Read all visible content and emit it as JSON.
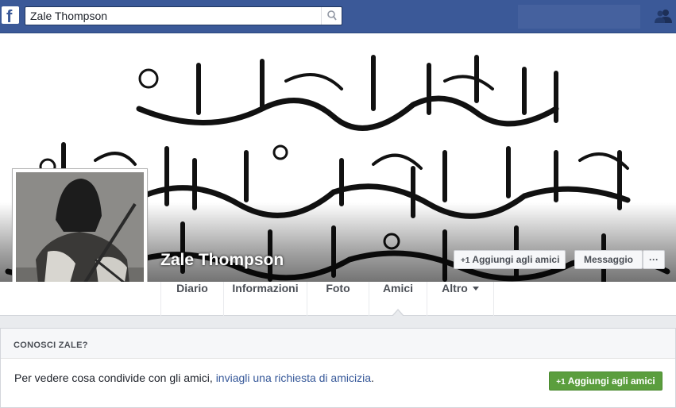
{
  "topbar": {
    "logo_letter": "f",
    "search_value": "Zale Thompson"
  },
  "profile": {
    "name": "Zale Thompson",
    "add_friend_label": "Aggiungi agli amici",
    "message_label": "Messaggio",
    "more_label": "···",
    "plus_one": "+1"
  },
  "tabs": [
    {
      "label": "Diario"
    },
    {
      "label": "Informazioni"
    },
    {
      "label": "Foto"
    },
    {
      "label": "Amici"
    },
    {
      "label": "Altro"
    }
  ],
  "friend_box": {
    "title": "CONOSCI ZALE?",
    "text_before_link": "Per vedere cosa condivide con gli amici, ",
    "link_text": "inviagli una richiesta di amicizia",
    "text_after_link": ".",
    "button_label": "Aggiungi agli amici",
    "button_plus_one": "+1"
  },
  "colors": {
    "brand_blue": "#3b5998",
    "link_blue": "#365899",
    "green_button": "#5b9e3e"
  }
}
